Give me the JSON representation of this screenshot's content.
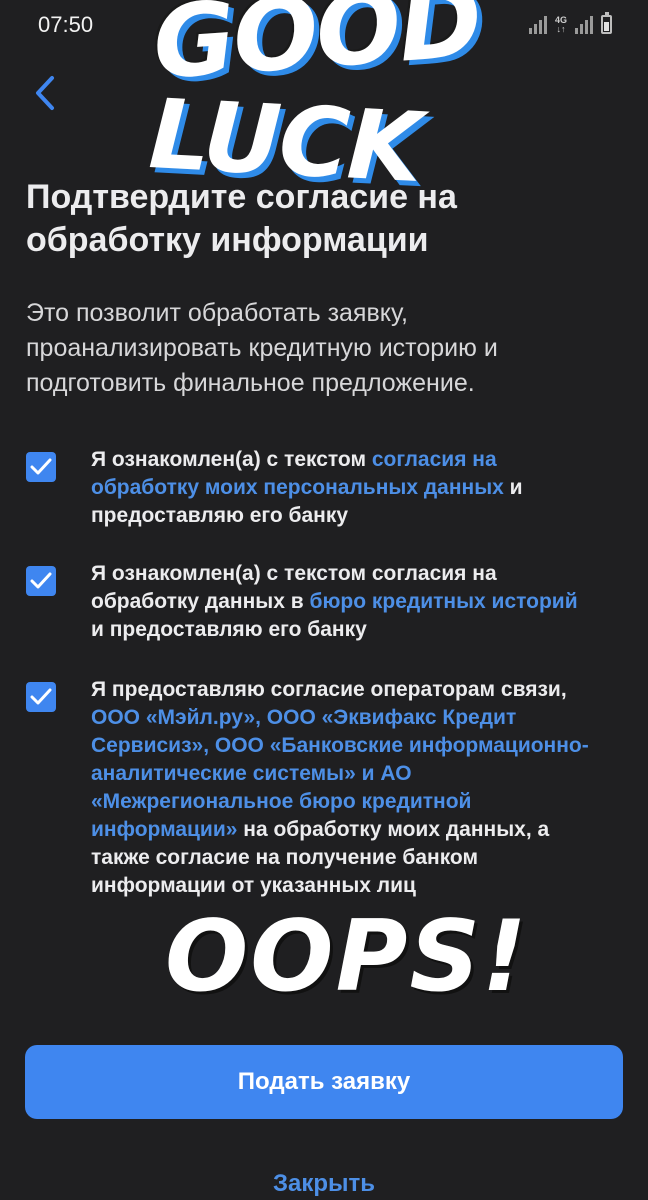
{
  "status_bar": {
    "time": "07:50",
    "network": "4G"
  },
  "stickers": {
    "good": "GOOD",
    "luck": "LUCK",
    "oops": "OOPS!"
  },
  "title": "Подтвердите согласие на обработку информации",
  "subtitle": "Это позволит обработать заявку, проанализировать кредитную историю и подготовить финальное предложение.",
  "consents": [
    {
      "checked": true,
      "p1": "Я ознакомлен(а) с текстом ",
      "link1": "согласия на обработку моих персональных данных",
      "p2": " и предоставляю его банку"
    },
    {
      "checked": true,
      "p1": "Я ознакомлен(а) с текстом согласия на обработку данных в ",
      "link1": "бюро кредитных историй",
      "p2": " и предоставляю его банку"
    },
    {
      "checked": true,
      "p1": "Я предоставляю согласие операторам связи, ",
      "link1": "ООО «Мэйл.ру», ООО «Эквифакс Кредит Сервисиз», ООО «Банковские информационно-аналитические системы» и АО «Межрегиональное бюро кредитной информации»",
      "p2": " на обработку моих данных, а также согласие на получение банком информации от указанных лиц"
    }
  ],
  "buttons": {
    "submit": "Подать заявку",
    "close": "Закрыть"
  },
  "colors": {
    "background": "#1f1f21",
    "accent": "#3f86f0",
    "link": "#4d8fe6",
    "text": "#ececee"
  }
}
